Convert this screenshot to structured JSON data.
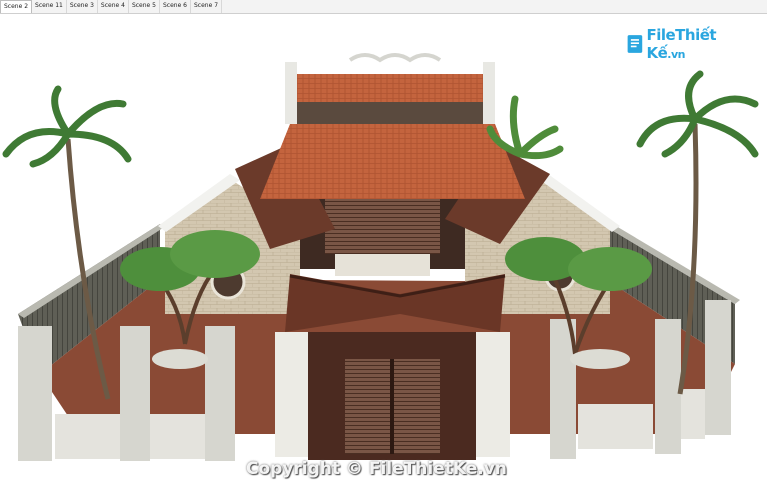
{
  "tabs": [
    {
      "label": "Scene 2",
      "active": true
    },
    {
      "label": "Scene 11",
      "active": false
    },
    {
      "label": "Scene 3",
      "active": false
    },
    {
      "label": "Scene 4",
      "active": false
    },
    {
      "label": "Scene 5",
      "active": false
    },
    {
      "label": "Scene 6",
      "active": false
    },
    {
      "label": "Scene 7",
      "active": false
    }
  ],
  "watermark": {
    "logo_main": "File",
    "logo_rest": "Thiết Kế",
    "logo_suffix": ".vn",
    "copyright": "Copyright © FileThietKe.vn"
  },
  "colors": {
    "roof_tile": "#c0603b",
    "dark_roof": "#6b3a2a",
    "wall_plaster": "#d8d4c8",
    "brick": "#c9bda6",
    "wood": "#5a3426",
    "ground": "#8a4a35",
    "fence": "#6e6e64",
    "logo": "#2aa6df"
  }
}
